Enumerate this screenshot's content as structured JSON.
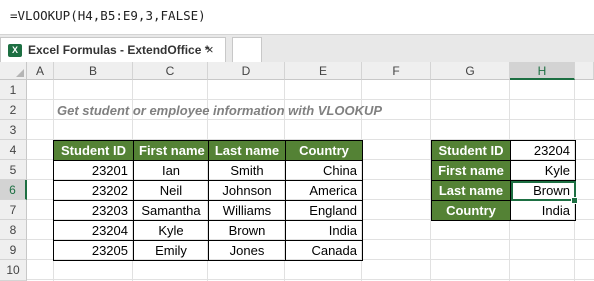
{
  "formula_bar": {
    "formula": "=VLOOKUP(H4,B5:E9,3,FALSE)"
  },
  "tabs": [
    {
      "label": "Excel Formulas - ExtendOffice *",
      "close_label": "×"
    }
  ],
  "icons": {
    "excel": "X"
  },
  "columns": [
    "A",
    "B",
    "C",
    "D",
    "E",
    "F",
    "G",
    "H"
  ],
  "rows": [
    "1",
    "2",
    "3",
    "4",
    "5",
    "6",
    "7",
    "8",
    "9",
    "10"
  ],
  "sheet": {
    "title": "Get student or employee information with VLOOKUP",
    "main_table": {
      "headers": [
        "Student ID",
        "First name",
        "Last name",
        "Country"
      ],
      "rows": [
        [
          "23201",
          "Ian",
          "Smith",
          "China"
        ],
        [
          "23202",
          "Neil",
          "Johnson",
          "America"
        ],
        [
          "23203",
          "Samantha",
          "Williams",
          "England"
        ],
        [
          "23204",
          "Kyle",
          "Brown",
          "India"
        ],
        [
          "23205",
          "Emily",
          "Jones",
          "Canada"
        ]
      ]
    },
    "lookup_table": {
      "rows": [
        {
          "label": "Student ID",
          "value": "23204"
        },
        {
          "label": "First name",
          "value": "Kyle"
        },
        {
          "label": "Last name",
          "value": "Brown"
        },
        {
          "label": "Country",
          "value": "India"
        }
      ]
    }
  },
  "colors": {
    "header_green": "#548235",
    "excel_green": "#1d6f42"
  }
}
